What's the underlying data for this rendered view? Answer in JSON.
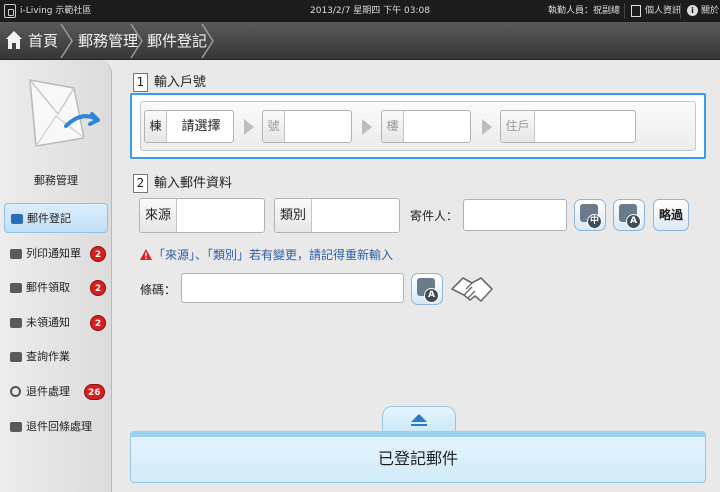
{
  "topbar": {
    "app_name": "i-Living 示範社區",
    "datetime": "2013/2/7 星期四 下午 03:08",
    "duty_staff": "執勤人員：祝副總",
    "personal_info": "個人資訊",
    "about": "關於"
  },
  "breadcrumb": [
    "首頁",
    "郵務管理",
    "郵件登記"
  ],
  "sidebar": {
    "title": "郵務管理",
    "items": [
      {
        "label": "郵件登記",
        "icon": "mail-icon",
        "badge": null,
        "active": true
      },
      {
        "label": "列印通知單",
        "icon": "printer-icon",
        "badge": "2",
        "active": false
      },
      {
        "label": "郵件領取",
        "icon": "package-icon",
        "badge": "2",
        "active": false
      },
      {
        "label": "未領通知",
        "icon": "phone-icon",
        "badge": "2",
        "active": false
      },
      {
        "label": "查詢作業",
        "icon": "search-book-icon",
        "badge": null,
        "active": false
      },
      {
        "label": "退件處理",
        "icon": "return-icon",
        "badge": "26",
        "active": false
      },
      {
        "label": "退件回條處理",
        "icon": "receipt-icon",
        "badge": null,
        "active": false
      }
    ]
  },
  "section1": {
    "number": "1",
    "title": "輸入戶號",
    "building_label": "棟",
    "building_value": "請選擇",
    "number_label": "號",
    "floor_label": "樓",
    "household_label": "住戶"
  },
  "section2": {
    "number": "2",
    "title": "輸入郵件資料",
    "source_label": "來源",
    "category_label": "類別",
    "sender_label": "寄件人：",
    "skip_button": "略過",
    "warning": "「來源」、「類別」若有變更，請記得重新輸入",
    "barcode_label": "條碼：",
    "kbd_chinese": "中",
    "kbd_alpha": "A"
  },
  "drawer": {
    "label": "已登記郵件"
  },
  "colors": {
    "accent": "#3a9be6",
    "badge": "#d81e1e",
    "warning_text": "#2b5fa8"
  }
}
